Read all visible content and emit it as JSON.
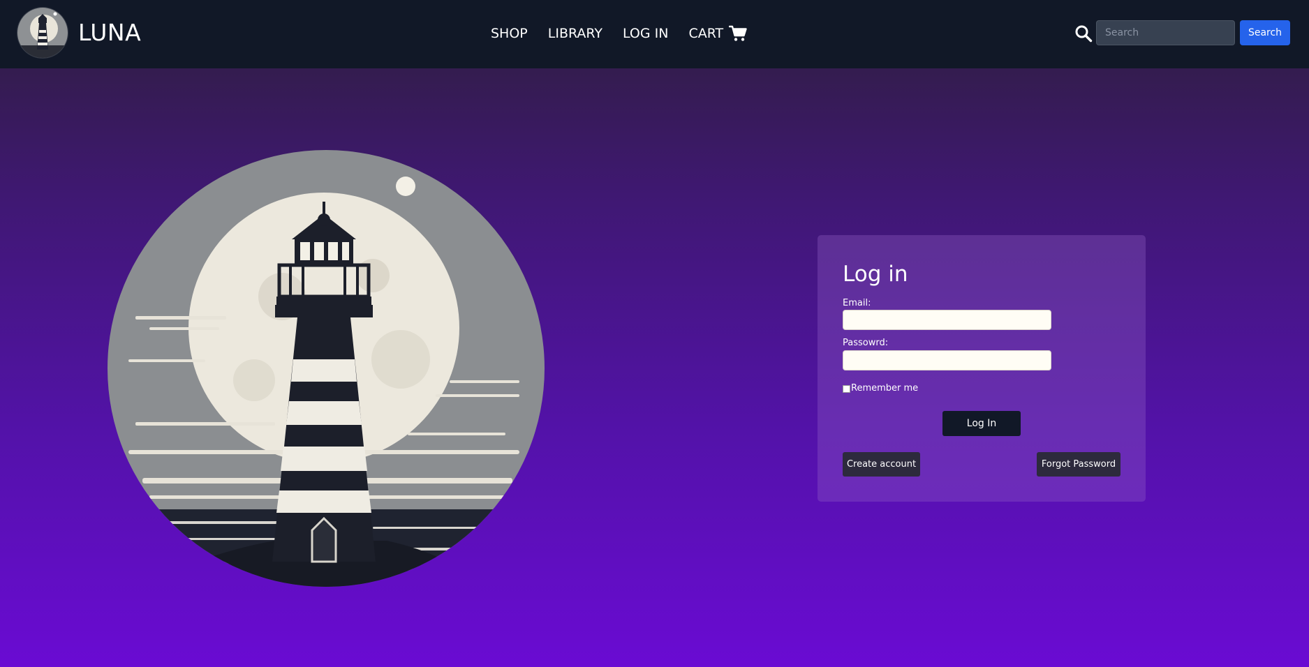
{
  "header": {
    "brand_name": "LUNA",
    "nav": [
      {
        "label": "SHOP"
      },
      {
        "label": "LIBRARY"
      },
      {
        "label": "LOG IN"
      },
      {
        "label": "CART"
      }
    ],
    "cart_icon": "shopping-cart-icon",
    "search_icon": "magnifier-icon",
    "search_placeholder": "Search",
    "search_button_label": "Search"
  },
  "hero": {
    "image": "lighthouse-and-full-moon-illustration"
  },
  "login": {
    "title": "Log in",
    "email_label": "Email:",
    "email_value": "",
    "password_label": "Passowrd:",
    "password_value": "",
    "remember_label": "Remember me",
    "remember_checked": false,
    "login_button_label": "Log In",
    "create_account_label": "Create account",
    "forgot_password_label": "Forgot Password"
  },
  "colors": {
    "navbar_bg": "#111827",
    "accent_blue": "#2563eb",
    "gradient_top": "#341c4f",
    "gradient_bottom": "#6a0bd3",
    "card_bg": "#5a3a88",
    "dark_button": "#111827",
    "secondary_button": "#2d2a3d"
  }
}
